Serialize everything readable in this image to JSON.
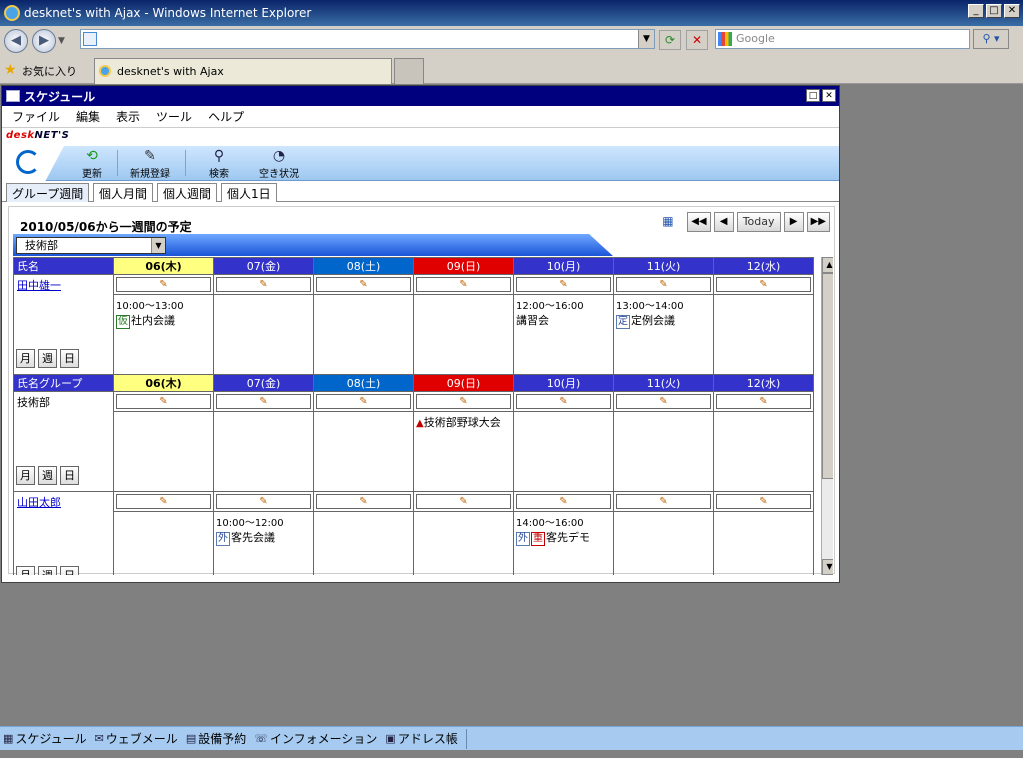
{
  "browser": {
    "title": "desknet's with Ajax - Windows Internet Explorer",
    "search_placeholder": "Google",
    "favorites_label": "お気に入り",
    "tab_title": "desknet's with Ajax"
  },
  "app": {
    "title": "スケジュール",
    "menu": [
      "ファイル",
      "編集",
      "表示",
      "ツール",
      "ヘルプ"
    ],
    "brand_red": "desk",
    "brand_dark": "NET'S",
    "toolbar": {
      "refresh": "更新",
      "new": "新規登録",
      "search": "検索",
      "availability": "空き状況"
    },
    "tabs": [
      "グループ週間",
      "個人月間",
      "個人週間",
      "個人1日"
    ],
    "heading": "2010/05/06から一週間の予定",
    "today_label": "Today",
    "group_select": "技術部",
    "days": [
      {
        "label": "06(木)",
        "kind": "today"
      },
      {
        "label": "07(金)",
        "kind": "weekday"
      },
      {
        "label": "08(土)",
        "kind": "sat"
      },
      {
        "label": "09(日)",
        "kind": "sun"
      },
      {
        "label": "10(月)",
        "kind": "weekday"
      },
      {
        "label": "11(火)",
        "kind": "weekday"
      },
      {
        "label": "12(水)",
        "kind": "weekday"
      }
    ],
    "header_name": "氏名",
    "header_group": "氏名グループ",
    "month_btn": "月",
    "week_btn": "週",
    "day_btn": "日",
    "pencil_icon": "✎",
    "rows": [
      {
        "name": "田中雄一",
        "events": {
          "0": {
            "time": "10:00〜13:00",
            "tag": "仮",
            "tag_color": "g",
            "title": "社内会議"
          },
          "4": {
            "time": "12:00〜16:00",
            "tag": "",
            "tag_color": "",
            "title": "講習会"
          },
          "5": {
            "time": "13:00〜14:00",
            "tag": "定",
            "tag_color": "b",
            "title": "定例会議"
          }
        }
      },
      {
        "name": "技術部",
        "events": {
          "3": {
            "flag": "▲",
            "title": "技術部野球大会"
          }
        }
      },
      {
        "name": "山田太郎",
        "events": {
          "1": {
            "time": "10:00〜12:00",
            "tag": "外",
            "tag_color": "b",
            "title": "客先会議"
          },
          "4": {
            "time": "14:00〜16:00",
            "tag": "外",
            "tag_color": "b",
            "tag2": "重",
            "tag2_color": "r",
            "title": "客先デモ"
          }
        }
      }
    ]
  },
  "taskbar": [
    "スケジュール",
    "ウェブメール",
    "設備予約",
    "インフォメーション",
    "アドレス帳"
  ]
}
